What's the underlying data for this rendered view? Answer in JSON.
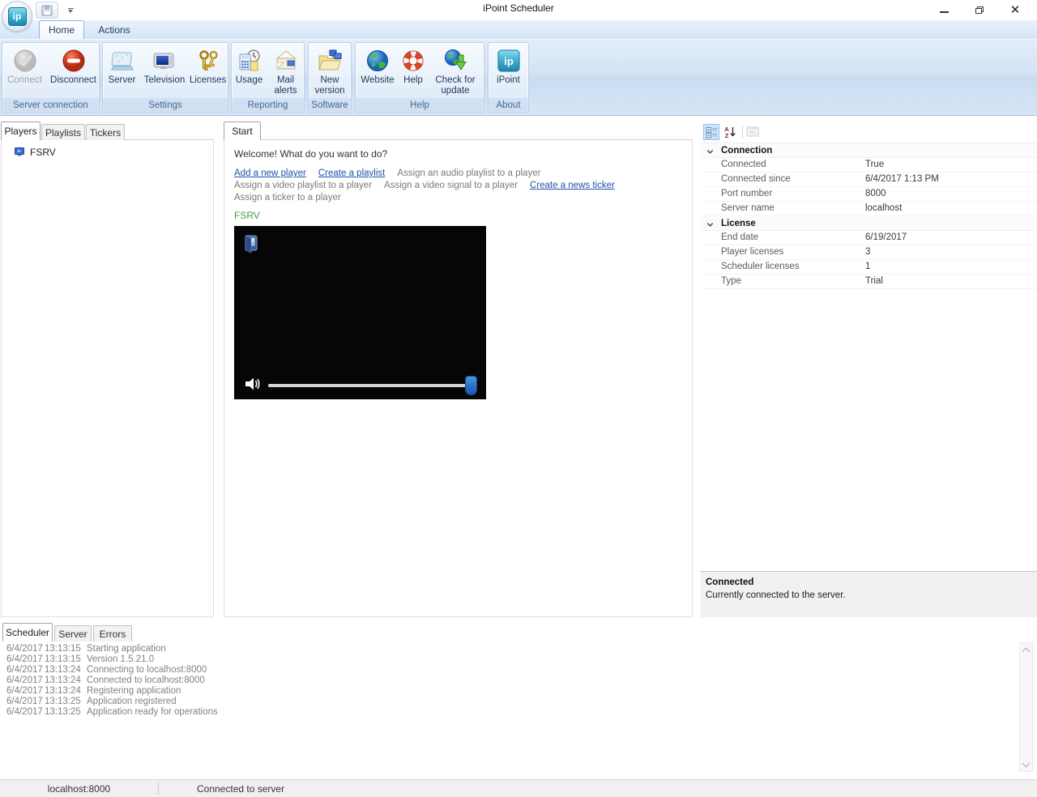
{
  "window": {
    "title": "iPoint Scheduler"
  },
  "ribbon": {
    "tabs": {
      "home": "Home",
      "actions": "Actions"
    },
    "groups": {
      "server_connection": {
        "label": "Server connection",
        "connect": "Connect",
        "disconnect": "Disconnect"
      },
      "settings": {
        "label": "Settings",
        "server": "Server",
        "television": "Television",
        "licenses": "Licenses"
      },
      "reporting": {
        "label": "Reporting",
        "usage": "Usage",
        "mail_alerts": "Mail alerts"
      },
      "software": {
        "label": "Software",
        "new_version": "New version"
      },
      "help": {
        "label": "Help",
        "website": "Website",
        "help": "Help",
        "check_update": "Check for update"
      },
      "about": {
        "label": "About",
        "ipoint": "iPoint"
      }
    }
  },
  "left_panel": {
    "tabs": {
      "players": "Players",
      "playlists": "Playlists",
      "tickers": "Tickers"
    },
    "tree": {
      "player_name": "FSRV"
    }
  },
  "main": {
    "tab": "Start",
    "welcome": "Welcome! What do you want to do?",
    "actions": {
      "add_player": "Add a new player",
      "create_playlist": "Create a playlist",
      "assign_audio": "Assign an audio playlist to a player",
      "assign_video_playlist": "Assign a video playlist to a player",
      "assign_video_signal": "Assign a video signal to a player",
      "create_ticker": "Create a news ticker",
      "assign_ticker": "Assign a ticker to a player"
    },
    "player": {
      "name": "FSRV"
    }
  },
  "properties": {
    "connection": {
      "label": "Connection",
      "rows": [
        {
          "name": "Connected",
          "value": "True"
        },
        {
          "name": "Connected since",
          "value": "6/4/2017 1:13 PM"
        },
        {
          "name": "Port number",
          "value": "8000"
        },
        {
          "name": "Server name",
          "value": "localhost"
        }
      ]
    },
    "license": {
      "label": "License",
      "rows": [
        {
          "name": "End date",
          "value": "6/19/2017"
        },
        {
          "name": "Player licenses",
          "value": "3"
        },
        {
          "name": "Scheduler licenses",
          "value": "1"
        },
        {
          "name": "Type",
          "value": "Trial"
        }
      ]
    },
    "description": {
      "title": "Connected",
      "text": "Currently connected to the server."
    }
  },
  "logs": {
    "tabs": {
      "scheduler": "Scheduler",
      "server": "Server",
      "errors": "Errors"
    },
    "entries": [
      {
        "date": "6/4/2017",
        "time": "13:13:15",
        "message": "Starting application"
      },
      {
        "date": "6/4/2017",
        "time": "13:13:15",
        "message": "Version 1.5.21.0"
      },
      {
        "date": "6/4/2017",
        "time": "13:13:24",
        "message": "Connecting to localhost:8000"
      },
      {
        "date": "6/4/2017",
        "time": "13:13:24",
        "message": "Connected to localhost:8000"
      },
      {
        "date": "6/4/2017",
        "time": "13:13:24",
        "message": "Registering application"
      },
      {
        "date": "6/4/2017",
        "time": "13:13:25",
        "message": "Application registered"
      },
      {
        "date": "6/4/2017",
        "time": "13:13:25",
        "message": "Application ready for operations"
      }
    ]
  },
  "status_bar": {
    "address": "localhost:8000",
    "status": "Connected to server"
  },
  "colors": {
    "link": "#1f52a8",
    "player_label_green": "#3f9e3f",
    "ribbon_label": "#44688e",
    "log_text": "#828282",
    "brand_teal": "#1b86ab",
    "disconnect_red": "#c8331b"
  }
}
